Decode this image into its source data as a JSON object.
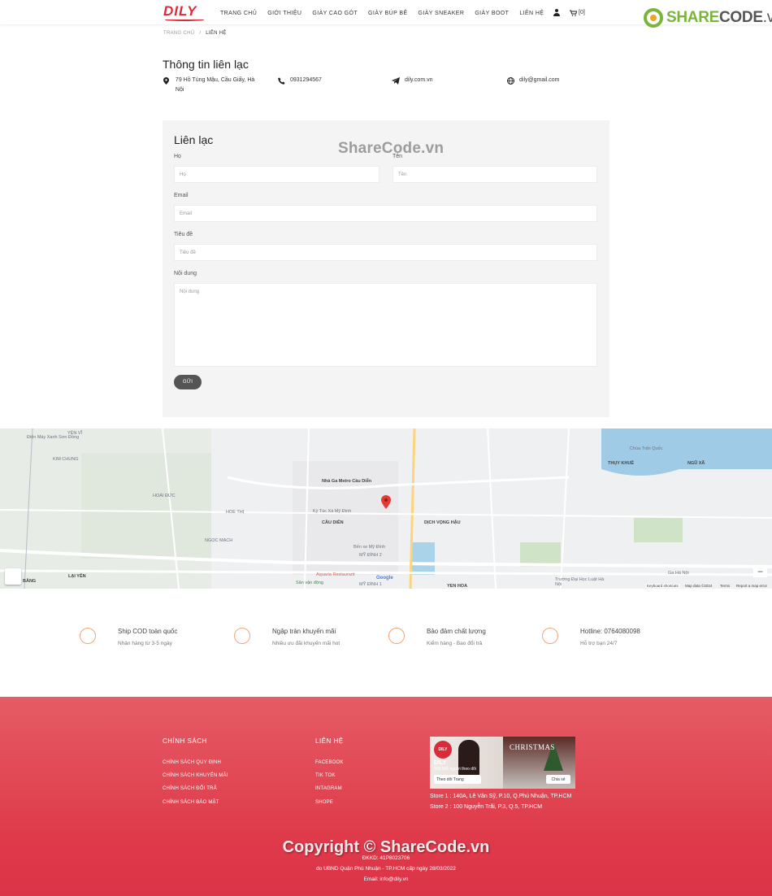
{
  "header": {
    "logo": "DILY",
    "nav": [
      "TRANG CHỦ",
      "GIỚI THIỆU",
      "GIÀY CAO GÓT",
      "GIÀY BÚP BÊ",
      "GIÀY SNEAKER",
      "GIÀY BOOT",
      "LIÊN HỆ"
    ],
    "cart_count": "[0]"
  },
  "watermark": {
    "brand_green": "SHARE",
    "brand_gray": "CODE",
    "brand_tld": ".vn",
    "middle": "ShareCode.vn",
    "bottom": "Copyright © ShareCode.vn"
  },
  "breadcrumb": {
    "home": "TRANG CHỦ",
    "separator": "/",
    "current": "LIÊN HỆ"
  },
  "contact_info": {
    "title": "Thông tin liên lạc",
    "address": "79 Hồ Tùng Mậu, Cầu Giấy, Hà Nội",
    "phone": "0931294567",
    "website": "dily.com.vn",
    "email": "dily@gmail.com"
  },
  "form": {
    "title": "Liên lạc",
    "last_name_label": "Họ",
    "last_name_placeholder": "Họ",
    "first_name_label": "Tên",
    "first_name_placeholder": "Tên",
    "email_label": "Email",
    "email_placeholder": "Email",
    "subject_label": "Tiêu đề",
    "subject_placeholder": "Tiêu đề",
    "message_label": "Nội dung",
    "message_placeholder": "Nội dung",
    "submit": "GỬI"
  },
  "map": {
    "labels": {
      "metro": "Nhà Ga Metro Cầu Diễn",
      "ktx": "Ký Túc Xá Mỹ Đình",
      "ben_xe": "Bến xe Mỹ Đình",
      "aquaria": "Aquaria Restaurant",
      "svd": "Sân vận động",
      "yen_vi": "YÊN VĨ",
      "kim_chung": "KIM CHUNG",
      "dien_may": "Điện Máy Xanh Sơn Đồng",
      "hoai_duc": "HOÀI ĐỨC",
      "hoe_thi": "HOE THỊ",
      "ngoc_mach": "NGỌC MẠCH",
      "cau_dien": "CẦU DIỄN",
      "my_dinh_2": "MỸ ĐÌNH 2",
      "my_dinh_1": "MỸ ĐÌNH 1",
      "dich_vong_hau": "DỊCH VỌNG HẬU",
      "yen_hoa": "YEN HOA",
      "chua_tran_quoc": "Chùa Trấn Quốc",
      "ngu_xa": "NGŨ XÃ",
      "thuy_khue": "THỤY KHUÊ",
      "ga_ha_noi": "Ga Hà Nội",
      "lai_yen": "LẠI YÊN",
      "bang": "BẰNG",
      "truong_dai": "Trường Đại Học Luật Hà Nội",
      "google": "Google",
      "shortcuts": "Keyboard shortcuts",
      "map_data": "Map data ©2024",
      "terms": "Terms",
      "report": "Report a map error"
    }
  },
  "features": [
    {
      "title": "Ship COD toàn quốc",
      "sub": "Nhận hàng từ 3-5 ngày"
    },
    {
      "title": "Ngập tràn khuyến mãi",
      "sub": "Nhiều ưu đãi khuyến mãi hot"
    },
    {
      "title": "Bảo đảm chất lượng",
      "sub": "Kiểm hàng - Bao đổi trả"
    },
    {
      "title": "Hotline: 0764080098",
      "sub": "Hỗ trợ bạn 24/7"
    }
  ],
  "footer": {
    "policy_title": "CHÍNH SÁCH",
    "policy_links": [
      "CHÍNH SÁCH QUY ĐỊNH",
      "CHÍNH SÁCH KHUYẾN MÃI",
      "CHÍNH SÁCH ĐỔI TRẢ",
      "CHÍNH SÁCH BẢO MẬT"
    ],
    "contact_title": "LIÊN HỆ",
    "contact_links": [
      "FACEBOOK",
      "TIK TOK",
      "INTAGRAM",
      "SHOPE"
    ],
    "fb_name": "DILY",
    "fb_followers": "669.595 người theo dõi",
    "fb_follow": "Theo dõi Trang",
    "fb_share": "Chia sẻ",
    "fb_banner": "CHRISTMAS",
    "store1": "Store 1 : 140A, Lê Văn Sỹ, P.10, Q.Phú Nhuận, TP.HCM",
    "store2": "Store 2 : 100 Nguyễn Trãi, P.3, Q.5, TP.HCM",
    "dkkd": "ĐKKD: 41P8023706",
    "issued": "do UBND Quận Phú Nhuận - TP.HCM cấp ngày 28/03/2022",
    "email": "Email: info@dily.vn"
  },
  "colors": {
    "brand": "#d92b3a",
    "footer": "#df3a4a",
    "accent": "#f3a57a"
  }
}
